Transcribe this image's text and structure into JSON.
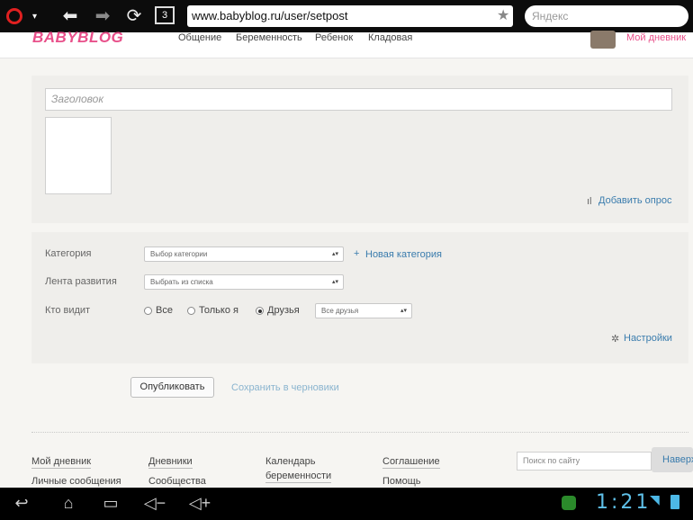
{
  "browser": {
    "tabs_count": "3",
    "url": "www.babyblog.ru/user/setpost",
    "search_placeholder": "Яндекс"
  },
  "site": {
    "logo": "BABYBLOG",
    "nav": [
      "Общение",
      "Беременность",
      "Ребенок",
      "Кладовая"
    ],
    "my_diary": "Мой дневник"
  },
  "form": {
    "title_placeholder": "Заголовок",
    "add_poll": "Добавить опрос",
    "category_label": "Категория",
    "category_select": "Выбор категории",
    "new_category": "Новая категория",
    "feed_label": "Лента развития",
    "feed_select": "Выбрать из списка",
    "who_sees_label": "Кто видит",
    "visibility": [
      "Все",
      "Только я",
      "Друзья"
    ],
    "visibility_selected": "Друзья",
    "friends_select": "Все друзья",
    "settings": "Настройки",
    "publish": "Опубликовать",
    "save_draft": "Сохранить в черновики"
  },
  "footer": {
    "col1": [
      "Мой дневник",
      "Личные сообщения"
    ],
    "col2": [
      "Дневники",
      "Сообщества"
    ],
    "col3": [
      "Календарь",
      "беременности"
    ],
    "col4": [
      "Соглашение",
      "Помощь"
    ],
    "search_placeholder": "Поиск по сайту",
    "to_top": "Наверх"
  },
  "system": {
    "clock": "1:21"
  },
  "colors": {
    "brand_pink": "#e8508a",
    "link_blue": "#3a7cad",
    "clock_blue": "#5fc0e8"
  }
}
